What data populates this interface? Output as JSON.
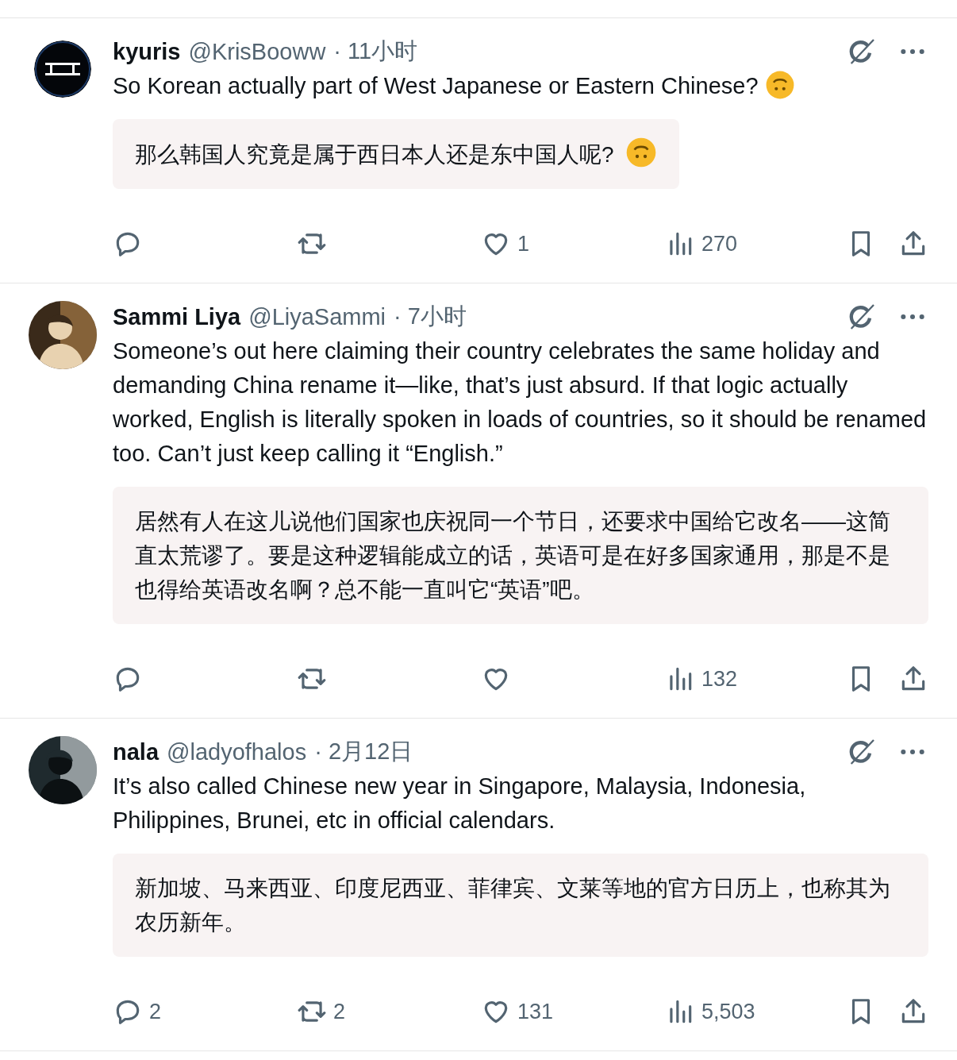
{
  "posts": [
    {
      "avatar": {
        "kind": "logo"
      },
      "name": "kyuris",
      "handle": "@KrisBooww",
      "time": "· 11小时",
      "text": "So Korean actually part of West Japanese or Eastern Chinese?",
      "text_emoji": true,
      "translation": "那么韩国人究竟是属于西日本人还是东中国人呢?",
      "translation_emoji": true,
      "actions": {
        "like": "1",
        "views": "270"
      }
    },
    {
      "name": "Sammi Liya",
      "handle": "@LiyaSammi",
      "time": "· 7小时",
      "text": "Someone’s out here claiming their country celebrates the same holiday and demanding China rename it—like, that’s just absurd. If that logic actually worked, English is literally spoken in loads of countries, so it should be renamed too. Can’t just keep calling it “English.”",
      "text_emoji": false,
      "translation": "居然有人在这儿说他们国家也庆祝同一个节日，还要求中国给它改名——这简直太荒谬了。要是这种逻辑能成立的话，英语可是在好多国家通用，那是不是也得给英语改名啊？总不能一直叫它“英语”吧。",
      "translation_emoji": false,
      "actions": {
        "views": "132"
      }
    },
    {
      "name": "nala",
      "handle": "@ladyofhalos",
      "time": "· 2月12日",
      "text": "It’s also called Chinese new year in Singapore, Malaysia, Indonesia, Philippines, Brunei, etc in official calendars.",
      "text_emoji": false,
      "translation": "新加坡、马来西亚、印度尼西亚、菲律宾、文莱等地的官方日历上，也称其为农历新年。",
      "translation_emoji": false,
      "actions": {
        "reply": "2",
        "retweet": "2",
        "like": "131",
        "views": "5,503"
      }
    }
  ]
}
